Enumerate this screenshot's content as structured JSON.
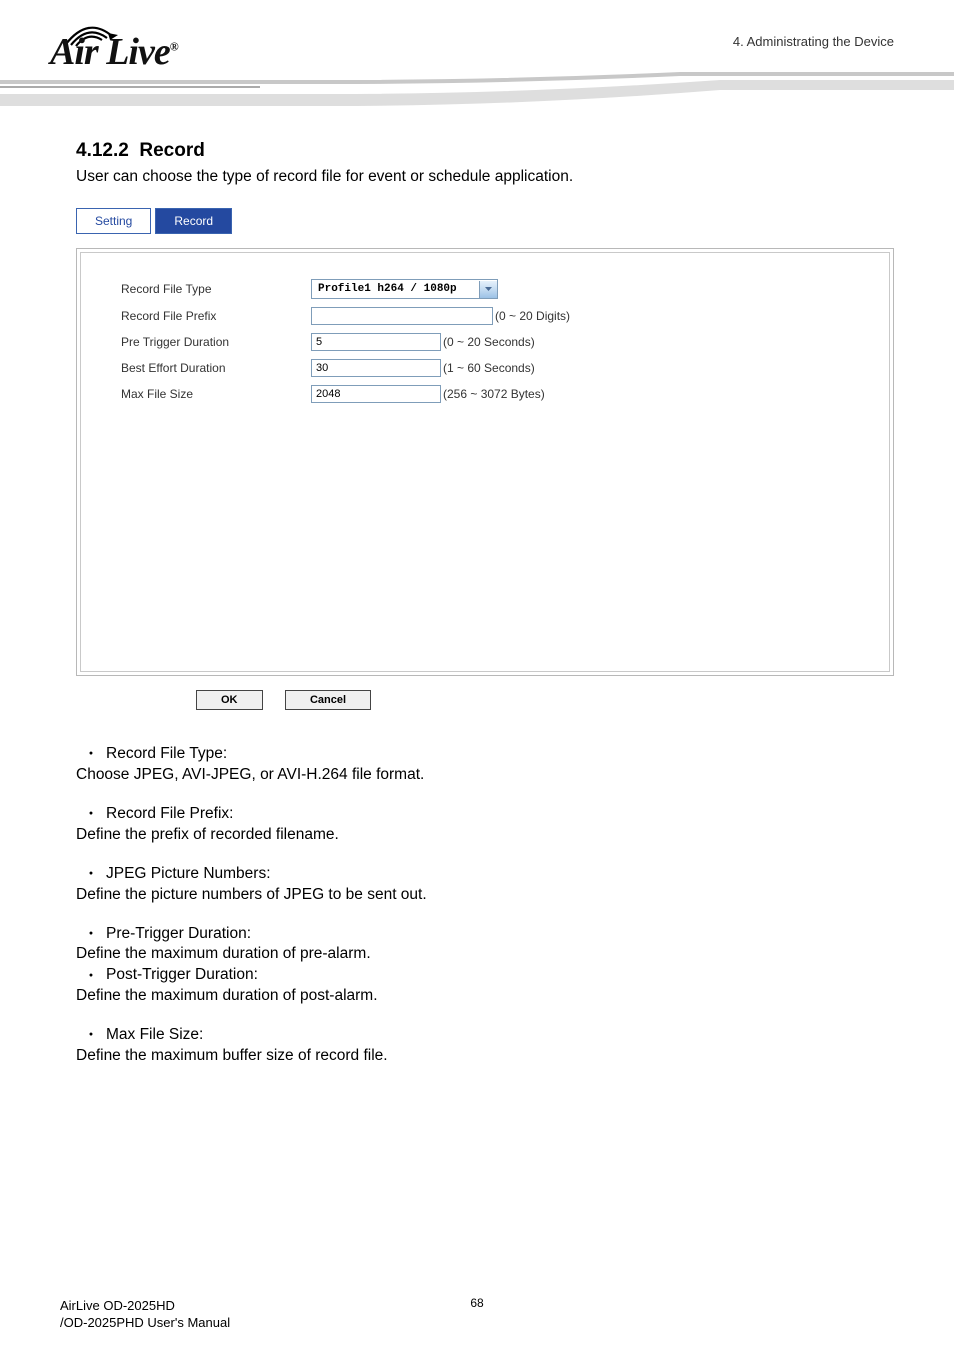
{
  "header": {
    "brand": "Air Live",
    "breadcrumb": "4. Administrating the Device"
  },
  "section": {
    "number": "4.12.2",
    "title": "Record",
    "description": "User can choose the type of record file for event or schedule application."
  },
  "tabs": {
    "setting": "Setting",
    "record": "Record"
  },
  "form": {
    "recordFileType": {
      "label": "Record File Type",
      "value": "Profile1 h264 / 1080p"
    },
    "recordFilePrefix": {
      "label": "Record File Prefix",
      "value": "",
      "hint": "(0 ~ 20 Digits)"
    },
    "preTrigger": {
      "label": "Pre Trigger Duration",
      "value": "5",
      "hint": "(0 ~ 20 Seconds)"
    },
    "bestEffort": {
      "label": "Best Effort Duration",
      "value": "30",
      "hint": "(1 ~ 60 Seconds)"
    },
    "maxFileSize": {
      "label": "Max File Size",
      "value": "2048",
      "hint": "(256 ~ 3072 Bytes)"
    }
  },
  "buttons": {
    "ok": "OK",
    "cancel": "Cancel"
  },
  "body": {
    "b1_title": "Record File Type:",
    "b1_text": "Choose JPEG, AVI-JPEG, or AVI-H.264 file format.",
    "b2_title": "Record File Prefix:",
    "b2_text": "Define the prefix of recorded filename.",
    "b3_title": "JPEG Picture Numbers:",
    "b3_text": "Define the picture numbers of JPEG to be sent out.",
    "b4_title": "Pre-Trigger Duration:",
    "b4_text": "Define the maximum duration of pre-alarm.",
    "b5_title": "Post-Trigger Duration:",
    "b5_text": "Define the maximum duration of post-alarm.",
    "b6_title": "Max File Size:",
    "b6_text": "Define the maximum buffer size of record file."
  },
  "footer": {
    "pageNumber": "68",
    "line1": "AirLive OD-2025HD",
    "line2": "/OD-2025PHD User's Manual"
  }
}
